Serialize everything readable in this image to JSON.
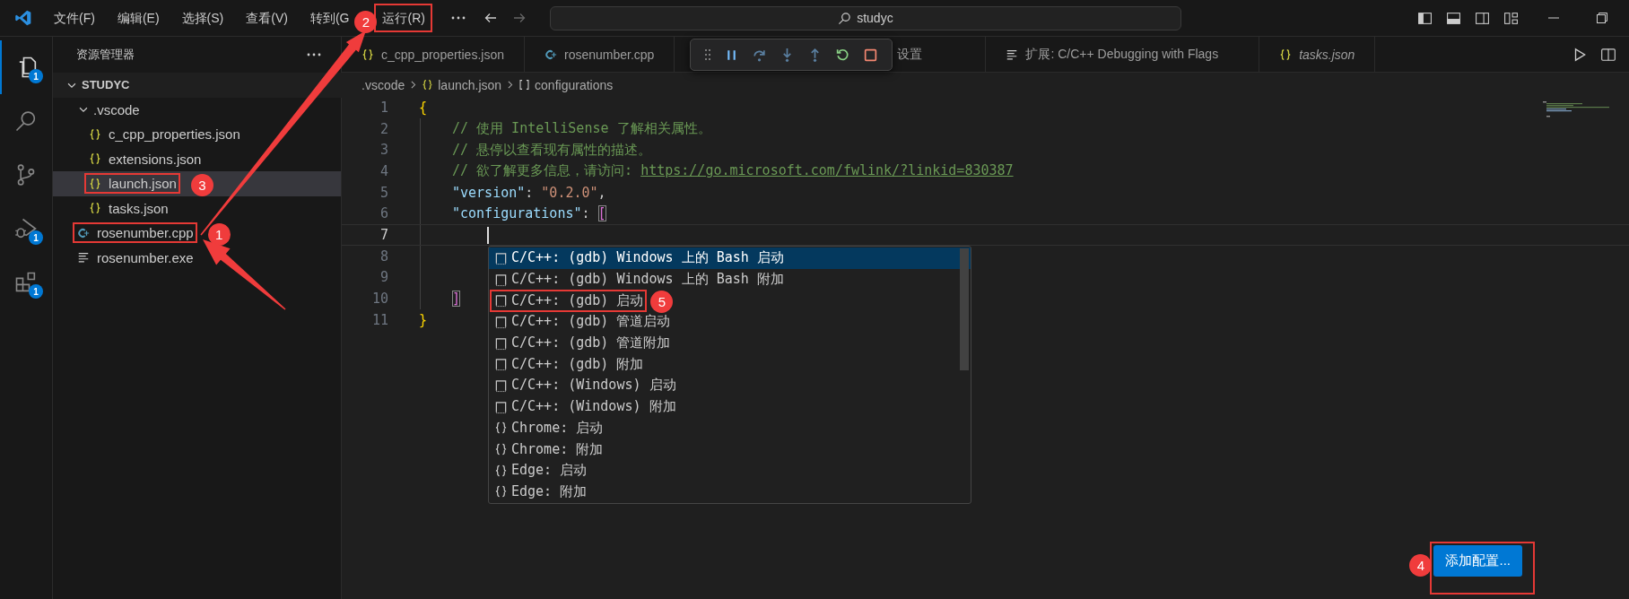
{
  "title_bar": {
    "menus": [
      {
        "label": "文件(F)"
      },
      {
        "label": "编辑(E)"
      },
      {
        "label": "选择(S)"
      },
      {
        "label": "查看(V)"
      },
      {
        "label": "转到(G"
      },
      {
        "label": "运行(R)",
        "callout": {
          "number": "2"
        }
      }
    ],
    "search": {
      "value": "studyc"
    }
  },
  "activity_bar": {
    "items": [
      {
        "kind": "explorer",
        "selected": true,
        "badge": "1"
      },
      {
        "kind": "search",
        "selected": false
      },
      {
        "kind": "source-control",
        "selected": false
      },
      {
        "kind": "run-debug",
        "selected": false,
        "badge": "1"
      },
      {
        "kind": "extensions",
        "selected": false,
        "badge": "1"
      }
    ]
  },
  "sidebar": {
    "title": "资源管理器",
    "tree": [
      {
        "label": "STUDYC",
        "kind": "root",
        "expanded": true,
        "selected": false,
        "children": [
          {
            "label": ".vscode",
            "kind": "folder",
            "expanded": true,
            "selected": false,
            "children": [
              {
                "label": "c_cpp_properties.json",
                "kind": "json",
                "selected": false
              },
              {
                "label": "extensions.json",
                "kind": "json",
                "selected": false
              },
              {
                "label": "launch.json",
                "kind": "json",
                "selected": true,
                "callout": {
                  "number": "3"
                }
              },
              {
                "label": "tasks.json",
                "kind": "json",
                "selected": false
              }
            ]
          },
          {
            "label": "rosenumber.cpp",
            "kind": "cpp",
            "selected": false,
            "callout": {
              "number": "1"
            }
          },
          {
            "label": "rosenumber.exe",
            "kind": "binary",
            "selected": false
          }
        ]
      }
    ]
  },
  "tabs": [
    {
      "label": "c_cpp_properties.json",
      "kind": "json",
      "preview": false
    },
    {
      "label": "rosenumber.cpp",
      "kind": "cpp",
      "preview": false
    },
    {
      "label": "设置",
      "kind": "settings",
      "preview": false
    },
    {
      "label": "扩展: C/C++ Debugging with Flags",
      "kind": "extension",
      "preview": false
    },
    {
      "label": "tasks.json",
      "kind": "json",
      "preview": true
    }
  ],
  "breadcrumb": [
    {
      "label": ".vscode",
      "kind": "folder"
    },
    {
      "label": "launch.json",
      "kind": "json"
    },
    {
      "label": "configurations",
      "kind": "array"
    }
  ],
  "editor": {
    "lines": [
      {
        "number": "1",
        "current": false,
        "indented": false,
        "segments": [
          {
            "kind": "brace",
            "text": "{"
          }
        ]
      },
      {
        "number": "2",
        "current": false,
        "indented": true,
        "segments": [
          {
            "kind": "comment",
            "text": "// 使用 IntelliSense 了解相关属性。"
          }
        ]
      },
      {
        "number": "3",
        "current": false,
        "indented": true,
        "segments": [
          {
            "kind": "comment",
            "text": "// 悬停以查看现有属性的描述。"
          }
        ]
      },
      {
        "number": "4",
        "current": false,
        "indented": true,
        "segments": [
          {
            "kind": "comment",
            "text": "// 欲了解更多信息，请访问: "
          },
          {
            "kind": "link",
            "text": "https://go.microsoft.com/fwlink/?linkid=830387"
          }
        ]
      },
      {
        "number": "5",
        "current": false,
        "indented": true,
        "segments": [
          {
            "kind": "key",
            "text": "\"version\""
          },
          {
            "kind": "punct",
            "text": ": "
          },
          {
            "kind": "string",
            "text": "\"0.2.0\""
          },
          {
            "kind": "punct",
            "text": ","
          }
        ]
      },
      {
        "number": "6",
        "current": false,
        "indented": true,
        "segments": [
          {
            "kind": "key",
            "text": "\"configurations\""
          },
          {
            "kind": "punct",
            "text": ": "
          },
          {
            "kind": "bracket-match",
            "text": "["
          }
        ]
      },
      {
        "number": "7",
        "current": true
      },
      {
        "number": "8",
        "current": false
      },
      {
        "number": "9",
        "current": false
      },
      {
        "number": "10",
        "current": false,
        "indented": true,
        "segments": [
          {
            "kind": "bracket-match",
            "text": "]"
          }
        ]
      },
      {
        "number": "11",
        "current": false,
        "indented": false,
        "segments": [
          {
            "kind": "brace",
            "text": "}"
          }
        ]
      }
    ]
  },
  "suggestions": [
    {
      "label": "C/C++: (gdb) Windows 上的 Bash 启动",
      "kind": "snippet",
      "selected": true
    },
    {
      "label": "C/C++: (gdb) Windows 上的 Bash 附加",
      "kind": "snippet",
      "selected": false
    },
    {
      "label": "C/C++: (gdb) 启动",
      "kind": "snippet",
      "selected": false,
      "callout": {
        "number": "5"
      }
    },
    {
      "label": "C/C++: (gdb) 管道启动",
      "kind": "snippet",
      "selected": false
    },
    {
      "label": "C/C++: (gdb) 管道附加",
      "kind": "snippet",
      "selected": false
    },
    {
      "label": "C/C++: (gdb) 附加",
      "kind": "snippet",
      "selected": false
    },
    {
      "label": "C/C++: (Windows) 启动",
      "kind": "snippet",
      "selected": false
    },
    {
      "label": "C/C++: (Windows) 附加",
      "kind": "snippet",
      "selected": false
    },
    {
      "label": "Chrome: 启动",
      "kind": "json",
      "selected": false
    },
    {
      "label": "Chrome: 附加",
      "kind": "json",
      "selected": false
    },
    {
      "label": "Edge: 启动",
      "kind": "json",
      "selected": false
    },
    {
      "label": "Edge: 附加",
      "kind": "json",
      "selected": false
    }
  ],
  "add_config_button": {
    "label": "添加配置...",
    "callout": {
      "number": "4"
    }
  }
}
